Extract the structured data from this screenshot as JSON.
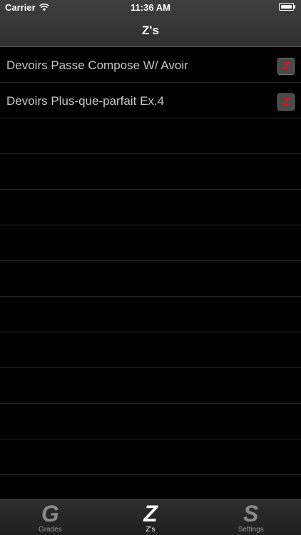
{
  "status_bar": {
    "carrier": "Carrier",
    "time": "11:36 AM"
  },
  "nav": {
    "title": "Z's"
  },
  "list": {
    "items": [
      {
        "label": "Devoirs Passe Compose W/ Avoir",
        "badge": "Z"
      },
      {
        "label": "Devoirs Plus-que-parfait Ex.4",
        "badge": "Z"
      }
    ]
  },
  "tabs": [
    {
      "icon_letter": "G",
      "label": "Grades"
    },
    {
      "icon_letter": "Z",
      "label": "Z's"
    },
    {
      "icon_letter": "S",
      "label": "Settings"
    }
  ],
  "colors": {
    "badge_text": "#d81818",
    "active_tab": "#ffffff",
    "inactive_tab": "#8a8a8a"
  }
}
